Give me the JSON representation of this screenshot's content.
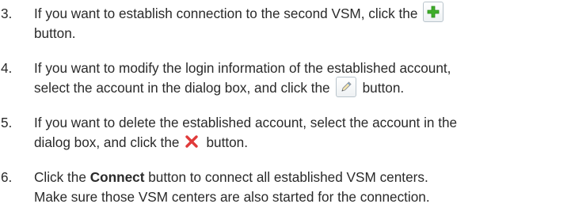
{
  "steps": [
    {
      "number": "3.",
      "line1_before_icon": "If you want to establish connection to the second VSM, click the",
      "icon": "add-icon",
      "line2": "button."
    },
    {
      "number": "4.",
      "line1": "If you want to modify the login information of the established account,",
      "line2_before_icon": "select the account in the dialog box, and click the",
      "icon": "edit-icon",
      "line2_after_icon": "button."
    },
    {
      "number": "5.",
      "line1": "If you want to delete the established account, select the account in the",
      "line2_before_icon": "dialog box, and click the",
      "icon": "delete-icon",
      "line2_after_icon": "button."
    },
    {
      "number": "6.",
      "line1_before_bold": "Click the",
      "line1_bold": "Connect",
      "line1_after_bold": "button to connect all established VSM centers.",
      "line2": "Make sure those VSM centers are also started for the connection."
    }
  ],
  "colors": {
    "text": "#2a2a2a",
    "add_icon_green": "#3fae2a",
    "delete_icon_red": "#e03a3a",
    "edit_icon_blue": "#5b8fc9"
  }
}
